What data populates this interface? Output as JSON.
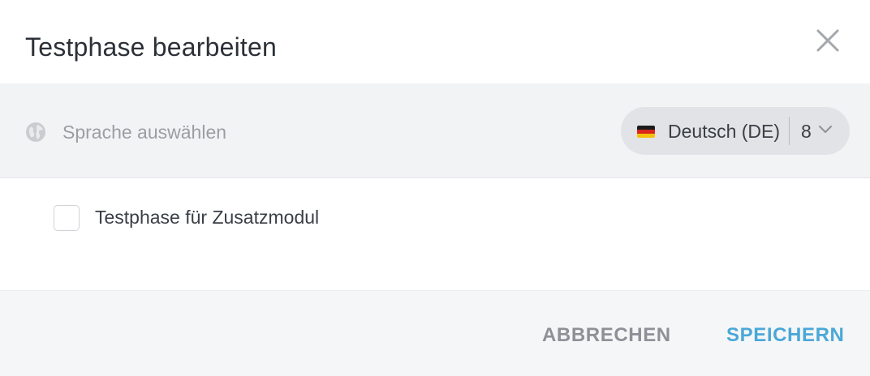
{
  "dialog": {
    "title": "Testphase bearbeiten",
    "close_icon": "close-icon"
  },
  "language": {
    "icon": "globe-icon",
    "label": "Sprache auswählen",
    "selected": "Deutsch (DE)",
    "flag_icon": "german-flag-icon",
    "count": "8",
    "chevron_icon": "chevron-down-icon"
  },
  "form": {
    "checkbox_label": "Testphase für Zusatzmodul",
    "checked": false
  },
  "footer": {
    "cancel_label": "ABBRECHEN",
    "save_label": "SPEICHERN"
  },
  "colors": {
    "accent": "#4aa8d8",
    "muted": "#8d9197",
    "bar_bg": "#f2f3f5",
    "footer_bg": "#f5f6f7"
  }
}
